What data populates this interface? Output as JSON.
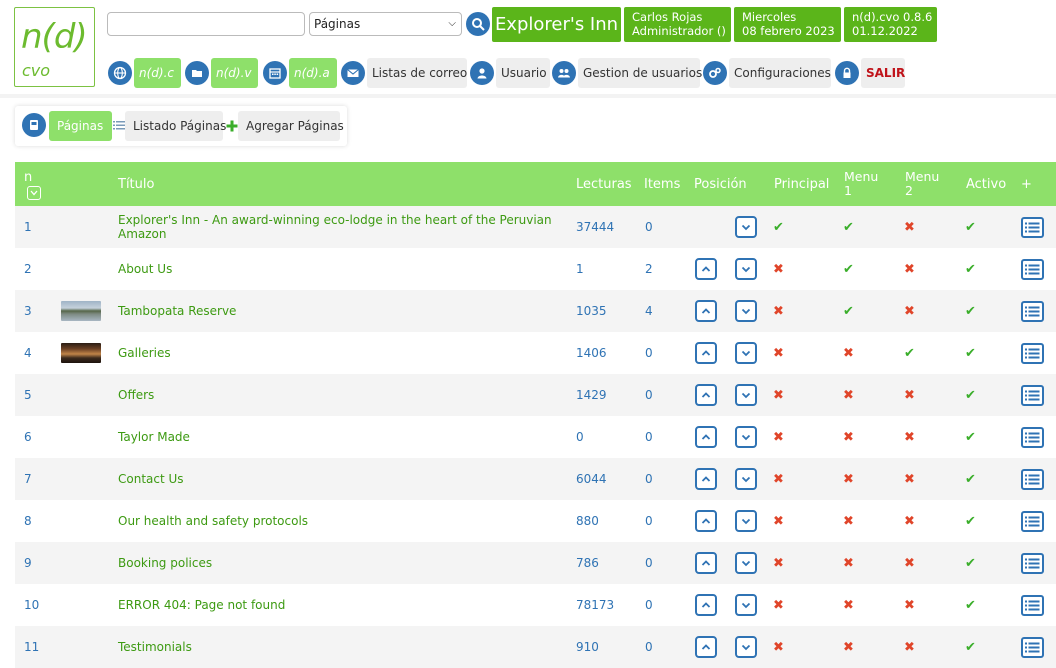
{
  "logo": {
    "main": "n(d)",
    "sub": "cvo"
  },
  "search": {
    "value": "",
    "placeholder": ""
  },
  "section_select": {
    "selected": "Páginas"
  },
  "site_name": "Explorer's Inn",
  "user": {
    "name": "Carlos Rojas",
    "role": "Administrador ()"
  },
  "date": {
    "weekday": "Miercoles",
    "date": "08 febrero 2023"
  },
  "version": {
    "name": "n(d).cvo 0.8.6",
    "date": "01.12.2022"
  },
  "nav": {
    "ndc": "n(d).c",
    "ndv": "n(d).v",
    "nda": "n(d).a",
    "mail_lists": "Listas de correo",
    "user": "Usuario",
    "user_mgmt": "Gestion de usuarios",
    "config": "Configuraciones",
    "logout": "SALIR"
  },
  "subnav": {
    "pages": "Páginas",
    "list": "Listado Páginas",
    "add": "Agregar Páginas"
  },
  "table": {
    "headers": {
      "n": "n",
      "title": "Título",
      "reads": "Lecturas",
      "items": "Items",
      "position": "Posición",
      "principal": "Principal",
      "menu1_a": "Menu",
      "menu1_b": "1",
      "menu2_a": "Menu",
      "menu2_b": "2",
      "active": "Activo",
      "plus": "+"
    },
    "rows": [
      {
        "n": "1",
        "title_1": "Explorer's Inn - An award-winning eco-lodge in the heart of the Peruvian",
        "title_2": "Amazon",
        "reads": "37444",
        "items": "0",
        "up": false,
        "principal": true,
        "menu1": true,
        "menu2": false,
        "active": true,
        "thumb": ""
      },
      {
        "n": "2",
        "title_1": "About Us",
        "title_2": "",
        "reads": "1",
        "items": "2",
        "up": true,
        "principal": false,
        "menu1": true,
        "menu2": false,
        "active": true,
        "thumb": ""
      },
      {
        "n": "3",
        "title_1": "Tambopata Reserve",
        "title_2": "",
        "reads": "1035",
        "items": "4",
        "up": true,
        "principal": false,
        "menu1": true,
        "menu2": false,
        "active": true,
        "thumb": "lake"
      },
      {
        "n": "4",
        "title_1": "Galleries",
        "title_2": "",
        "reads": "1406",
        "items": "0",
        "up": true,
        "principal": false,
        "menu1": false,
        "menu2": true,
        "active": true,
        "thumb": "sunset"
      },
      {
        "n": "5",
        "title_1": "Offers",
        "title_2": "",
        "reads": "1429",
        "items": "0",
        "up": true,
        "principal": false,
        "menu1": false,
        "menu2": false,
        "active": true,
        "thumb": ""
      },
      {
        "n": "6",
        "title_1": "Taylor Made",
        "title_2": "",
        "reads": "0",
        "items": "0",
        "up": true,
        "principal": false,
        "menu1": false,
        "menu2": false,
        "active": true,
        "thumb": ""
      },
      {
        "n": "7",
        "title_1": "Contact Us",
        "title_2": "",
        "reads": "6044",
        "items": "0",
        "up": true,
        "principal": false,
        "menu1": false,
        "menu2": false,
        "active": true,
        "thumb": ""
      },
      {
        "n": "8",
        "title_1": "Our health and safety protocols",
        "title_2": "",
        "reads": "880",
        "items": "0",
        "up": true,
        "principal": false,
        "menu1": false,
        "menu2": false,
        "active": true,
        "thumb": ""
      },
      {
        "n": "9",
        "title_1": "Booking polices",
        "title_2": "",
        "reads": "786",
        "items": "0",
        "up": true,
        "principal": false,
        "menu1": false,
        "menu2": false,
        "active": true,
        "thumb": ""
      },
      {
        "n": "10",
        "title_1": "ERROR 404: Page not found",
        "title_2": "",
        "reads": "78173",
        "items": "0",
        "up": true,
        "principal": false,
        "menu1": false,
        "menu2": false,
        "active": true,
        "thumb": ""
      },
      {
        "n": "11",
        "title_1": "Testimonials",
        "title_2": "",
        "reads": "910",
        "items": "0",
        "up": true,
        "principal": false,
        "menu1": false,
        "menu2": false,
        "active": true,
        "thumb": ""
      }
    ]
  },
  "colors": {
    "brand_green": "#5bb51a",
    "light_green": "#8ee06a",
    "blue": "#2f73b4",
    "title_green": "#3d9a12",
    "no_red": "#e0452a"
  }
}
